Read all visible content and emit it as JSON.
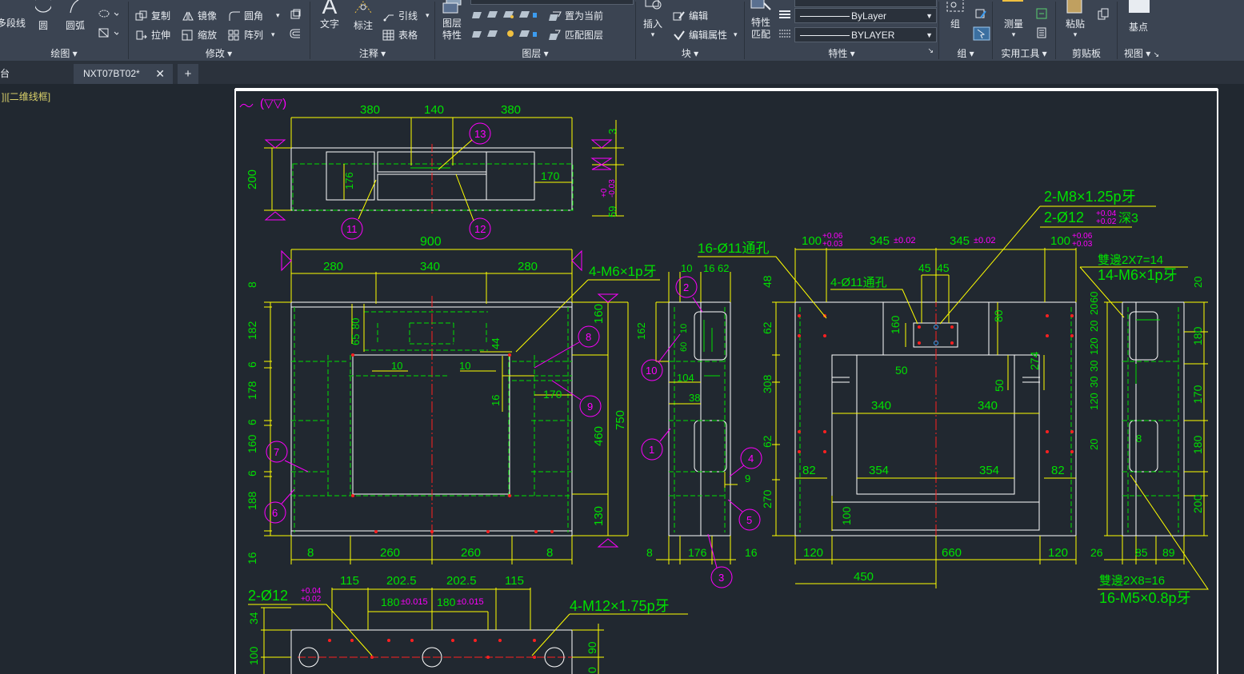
{
  "ribbon": {
    "draw": {
      "title": "绘图",
      "polyline": "多段线",
      "circle": "圆",
      "arc": "圆弧"
    },
    "modify": {
      "title": "修改",
      "copy": "复制",
      "mirror": "镜像",
      "fillet": "圆角",
      "stretch": "拉伸",
      "scale": "缩放",
      "array": "阵列"
    },
    "annotation": {
      "title": "注释",
      "text": "文字",
      "dimension": "标注",
      "leader": "引线",
      "table": "表格"
    },
    "layers": {
      "title": "图层",
      "layer_properties": "图层\n特性",
      "set_current": "置为当前",
      "match_layer": "匹配图层"
    },
    "block": {
      "title": "块",
      "insert": "插入",
      "edit": "编辑",
      "edit_attributes": "编辑属性"
    },
    "properties": {
      "title": "特性",
      "match_properties": "特性\n匹配",
      "linetype": "ByLayer",
      "lineweight": "BYLAYER"
    },
    "group": {
      "title": "组",
      "group": "组"
    },
    "utilities": {
      "title": "实用工具",
      "measure": "测量"
    },
    "clipboard": {
      "title": "剪贴板",
      "paste": "粘贴"
    },
    "view": {
      "title": "视图",
      "base": "基点"
    }
  },
  "tabs": [
    {
      "label": "台"
    },
    {
      "label": "NXT07BT02*"
    }
  ],
  "viewport_label": "]|[二维线框]",
  "colors": {
    "background": "#212830",
    "ribbon": "#3b4452",
    "yellow": "#ffff00",
    "green": "#00e000",
    "magenta": "#ff00ff",
    "white": "#ffffff",
    "red": "#ff2020"
  },
  "drawing": {
    "surface_symbol": "(▽▽)",
    "top_view": {
      "dims": [
        "380",
        "140",
        "380",
        "200",
        "176",
        "170",
        "3",
        "59",
        "+0",
        "-0.03"
      ],
      "balloons": [
        "13",
        "11",
        "12"
      ]
    },
    "front_view": {
      "dims_top": [
        "900",
        "280",
        "340",
        "280"
      ],
      "note_tap": "4-M6×1p牙",
      "dims_left": [
        "8",
        "182",
        "6",
        "178",
        "6",
        "160",
        "6",
        "188",
        "16"
      ],
      "dims_inner": [
        "80",
        "65",
        "10",
        "10",
        "44",
        "16",
        "170"
      ],
      "dims_right": [
        "160",
        "750",
        "460",
        "130"
      ],
      "dims_bottom": [
        "8",
        "260",
        "260",
        "8"
      ],
      "balloons": [
        "8",
        "9",
        "7",
        "6"
      ]
    },
    "side_view": {
      "dims": [
        "10",
        "16",
        "62",
        "162",
        "10",
        "60",
        "104",
        "38",
        "9",
        "8",
        "176",
        "16"
      ],
      "balloons": [
        "2",
        "10",
        "1",
        "4",
        "5",
        "3"
      ]
    },
    "back_view": {
      "note_holes16": "16-Ø11通孔",
      "note_holes4": "4-Ø11通孔",
      "note_m8": "2-M8×1.25p牙",
      "note_d12": "2-Ø12",
      "note_d12_tol_up": "+0.04",
      "note_d12_tol_dn": "+0.02",
      "note_d12_suffix": "深3",
      "dim_100_left": "100",
      "dim_345_left": "345",
      "dim_345_right": "345",
      "dim_100_right": "100",
      "tol_006": "+0.06",
      "tol_003": "+0.03",
      "tol_002": "±0.02",
      "dims_v": [
        "48",
        "62",
        "308",
        "62",
        "270",
        "160",
        "80",
        "274",
        "50",
        "100"
      ],
      "dims_h": [
        "45",
        "45",
        "50",
        "340",
        "340",
        "82",
        "354",
        "354",
        "82",
        "120",
        "660",
        "120",
        "450"
      ]
    },
    "right_view": {
      "note_countersink14": "雙邊2X7=14",
      "note_m6": "14-M6×1p牙",
      "note_countersink16": "雙邊2X8=16",
      "note_m5": "16-M5×0.8p牙",
      "dims_left": [
        "20",
        "60",
        "20",
        "120",
        "30",
        "30",
        "120",
        "20"
      ],
      "dims_right": [
        "20",
        "180",
        "170",
        "180",
        "200"
      ],
      "dims_bottom": [
        "26",
        "85",
        "89"
      ],
      "dim_8": "8"
    },
    "bottom_view": {
      "note_d12": "2-Ø12",
      "note_d12_tol_up": "+0.04",
      "note_d12_tol_dn": "+0.02",
      "note_m12": "4-M12×1.75p牙",
      "dims_top": [
        "115",
        "202.5",
        "202.5",
        "115"
      ],
      "dim_180_a": "180",
      "dim_180_b": "180",
      "tol_0015": "±0.015",
      "dims_left": [
        "34",
        "100"
      ],
      "dims_right": [
        "90",
        "0"
      ]
    }
  }
}
